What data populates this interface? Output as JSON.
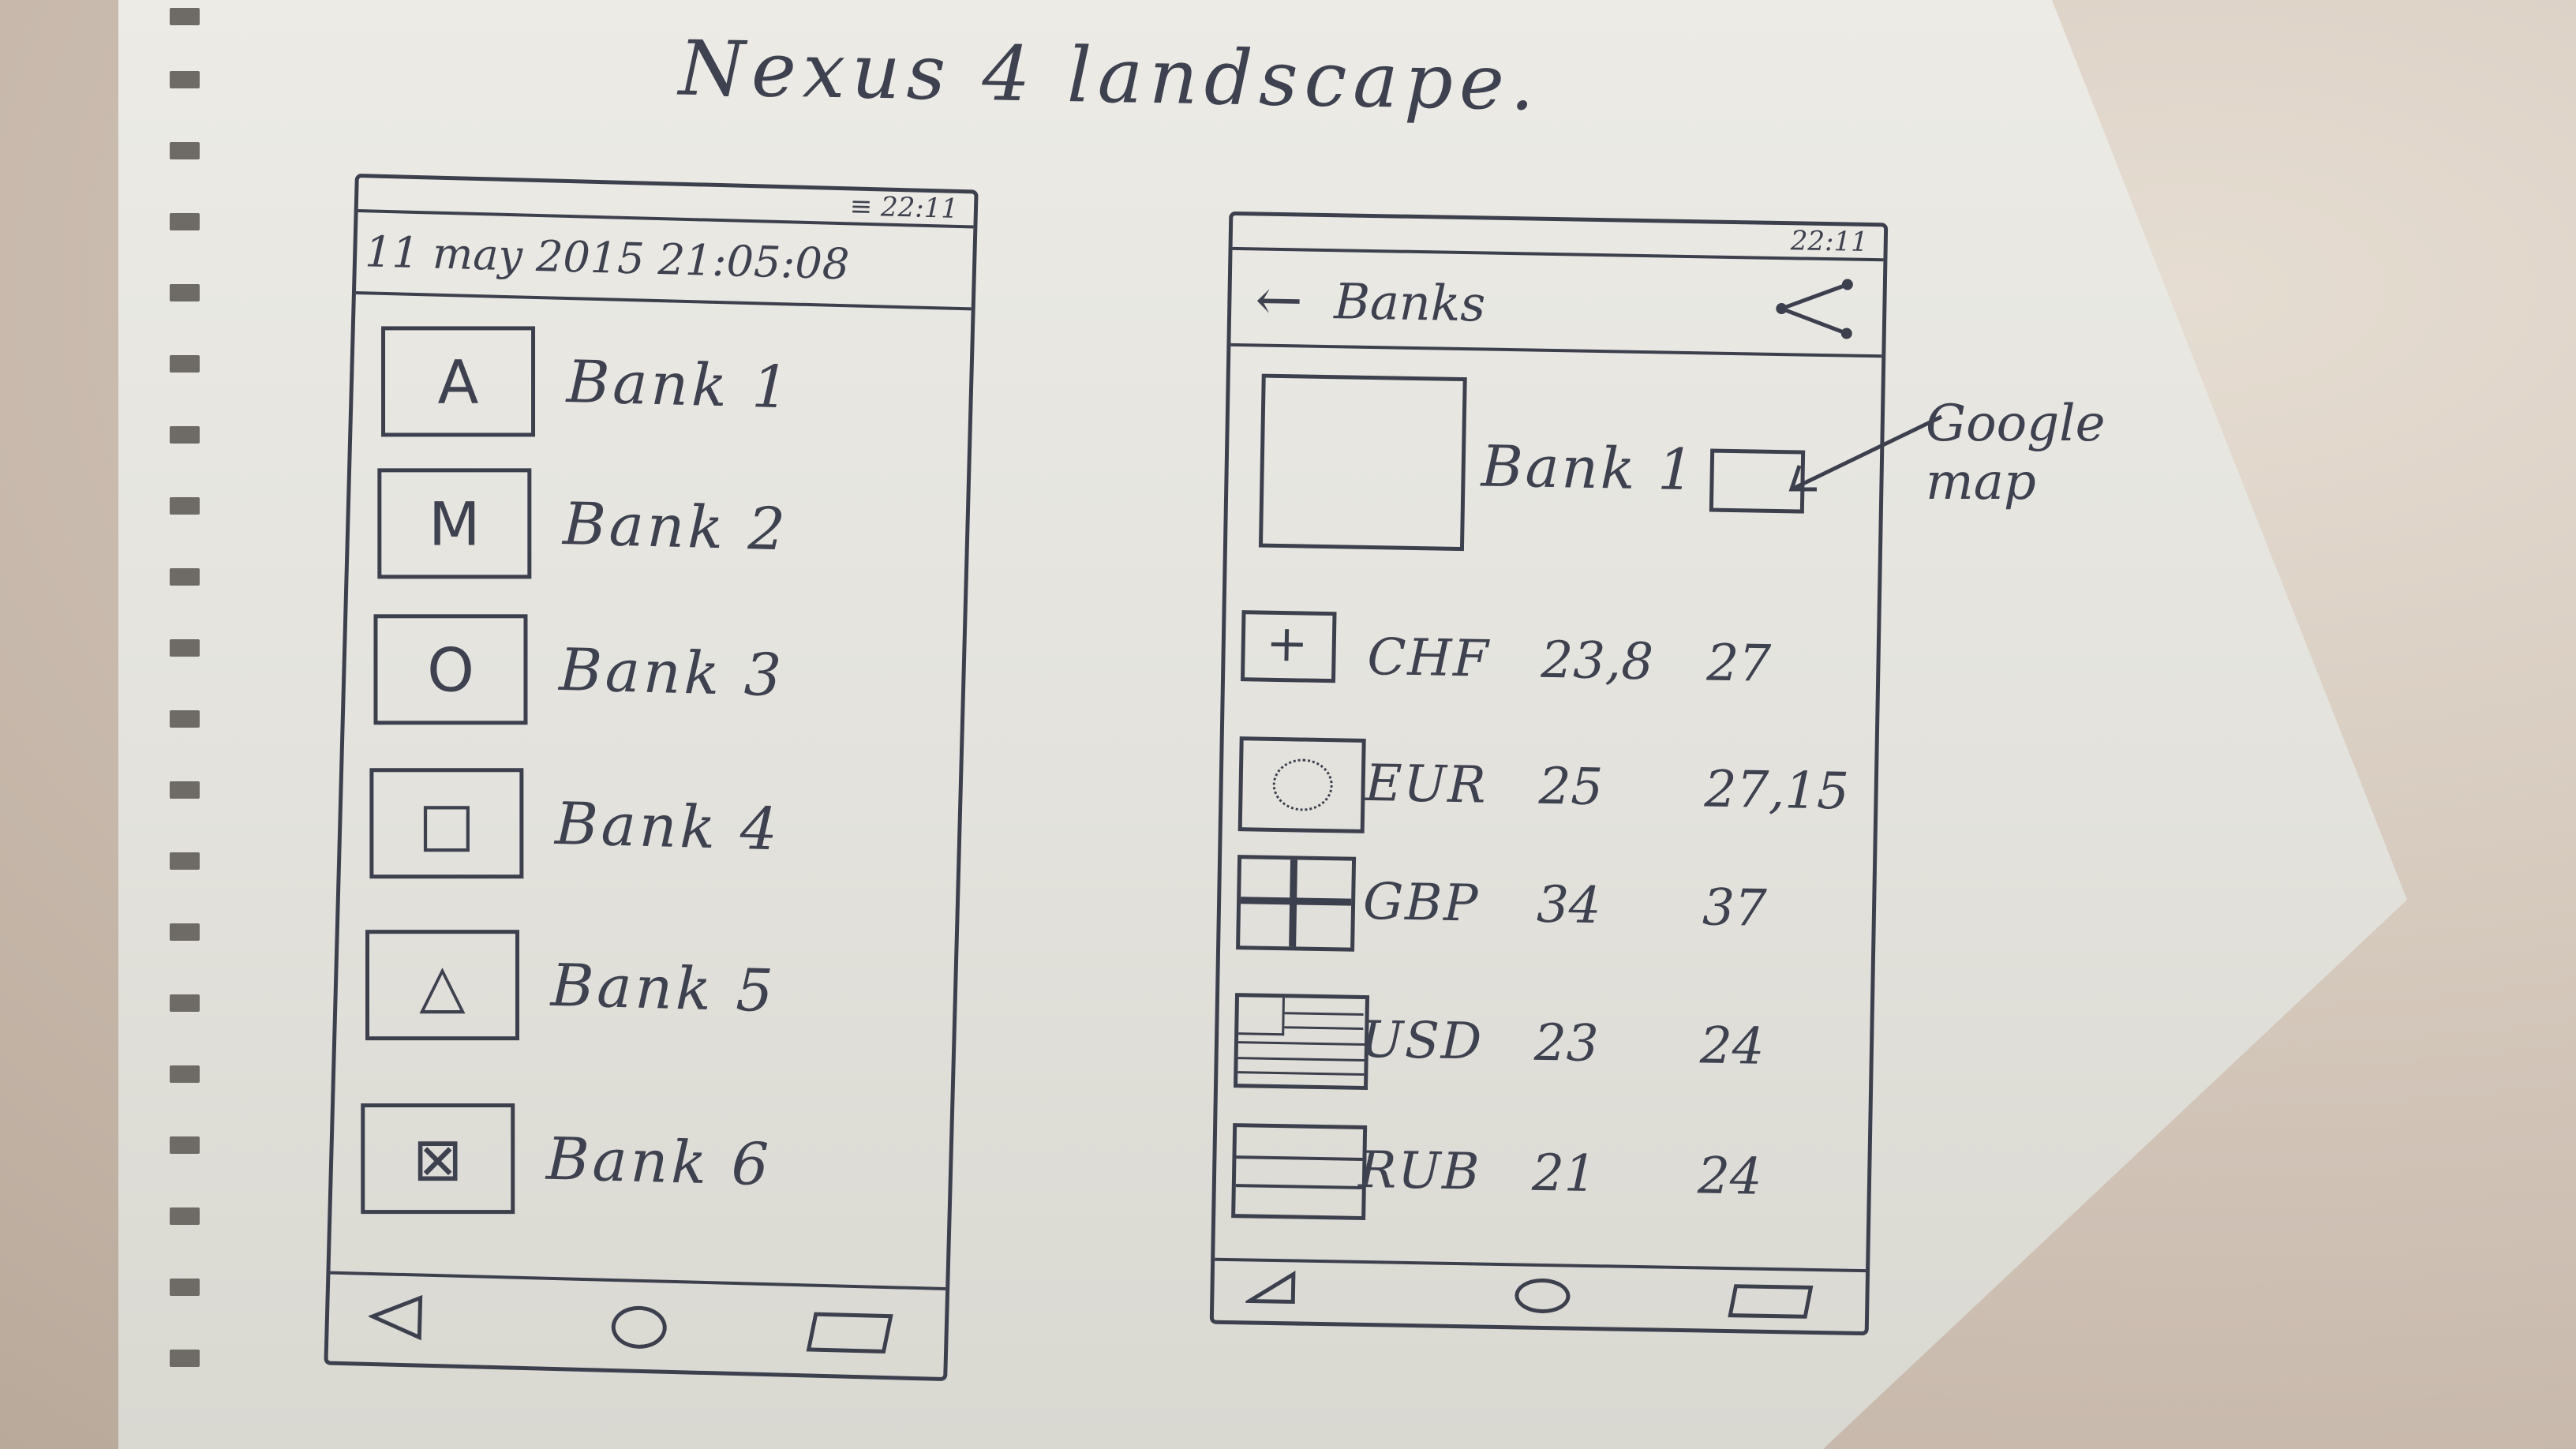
{
  "title": "Nexus 4 landscape.",
  "left_screen": {
    "status_time": "≡ 22:11",
    "date_header": "11 may 2015 21:05:08",
    "banks": [
      {
        "logo": "A",
        "name": "Bank 1"
      },
      {
        "logo": "M",
        "name": "Bank 2"
      },
      {
        "logo": "O",
        "name": "Bank 3"
      },
      {
        "logo": "□",
        "name": "Bank 4"
      },
      {
        "logo": "△",
        "name": "Bank 5"
      },
      {
        "logo": "⊠",
        "name": "Bank 6"
      }
    ]
  },
  "right_screen": {
    "status_time": "22:11",
    "app_bar_title": "Banks",
    "back_icon": "arrow-left",
    "share_icon": "share",
    "bank_name": "Bank 1",
    "map_annotation": [
      "Google",
      "map"
    ],
    "rates": [
      {
        "flag": "chf-flag",
        "currency": "CHF",
        "buy": "23,8",
        "sell": "27"
      },
      {
        "flag": "eur-flag",
        "currency": "EUR",
        "buy": "25",
        "sell": "27,15"
      },
      {
        "flag": "gbp-flag",
        "currency": "GBP",
        "buy": "34",
        "sell": "37"
      },
      {
        "flag": "usd-flag",
        "currency": "USD",
        "buy": "23",
        "sell": "24"
      },
      {
        "flag": "rub-flag",
        "currency": "RUB",
        "buy": "21",
        "sell": "24"
      }
    ]
  }
}
